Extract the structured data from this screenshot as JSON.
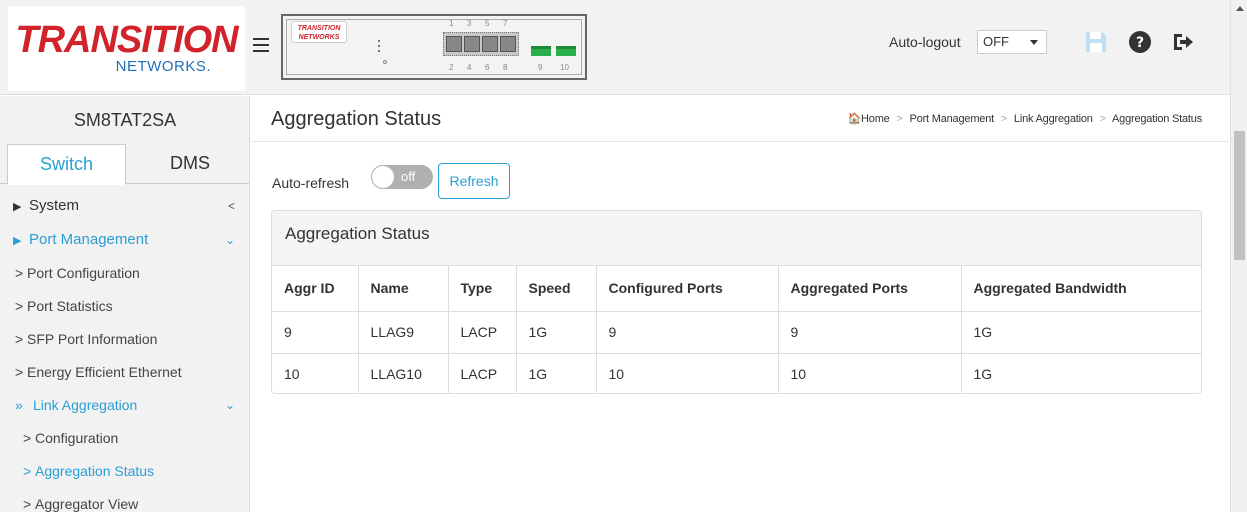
{
  "header": {
    "logo_main": "TRANSITION",
    "logo_sub": "NETWORKS.",
    "device_logo": "TRANSITION NETWORKS",
    "port_numbers_top": [
      "1",
      "3",
      "5",
      "7"
    ],
    "port_numbers_bottom": [
      "2",
      "4",
      "6",
      "8",
      "9",
      "10"
    ],
    "auto_logout_label": "Auto-logout",
    "auto_logout_value": "OFF"
  },
  "sidebar": {
    "model": "SM8TAT2SA",
    "tabs": [
      {
        "label": "Switch",
        "active": true
      },
      {
        "label": "DMS",
        "active": false
      }
    ],
    "menu": {
      "system": "System",
      "port_management": "Port Management",
      "port_configuration": "Port Configuration",
      "port_statistics": "Port Statistics",
      "sfp_port_information": "SFP Port Information",
      "energy_efficient_ethernet": "Energy Efficient Ethernet",
      "link_aggregation": "Link Aggregation",
      "configuration": "Configuration",
      "aggregation_status": "Aggregation Status",
      "aggregator_view": "Aggregator View"
    }
  },
  "main": {
    "title": "Aggregation Status",
    "breadcrumb": [
      "Home",
      "Port Management",
      "Link Aggregation",
      "Aggregation Status"
    ],
    "auto_refresh_label": "Auto-refresh",
    "toggle_text": "off",
    "refresh_label": "Refresh",
    "panel_title": "Aggregation Status",
    "table": {
      "columns": [
        "Aggr ID",
        "Name",
        "Type",
        "Speed",
        "Configured Ports",
        "Aggregated Ports",
        "Aggregated Bandwidth"
      ],
      "rows": [
        [
          "9",
          "LLAG9",
          "LACP",
          "1G",
          "9",
          "9",
          "1G"
        ],
        [
          "10",
          "LLAG10",
          "LACP",
          "1G",
          "10",
          "10",
          "1G"
        ]
      ]
    }
  },
  "colors": {
    "accent": "#2a9fd6",
    "brand_red": "#d2232a",
    "sfp_green": "#2ab04b"
  },
  "icons": [
    "save-icon",
    "help-icon",
    "logout-icon",
    "home-icon",
    "hamburger-icon"
  ]
}
